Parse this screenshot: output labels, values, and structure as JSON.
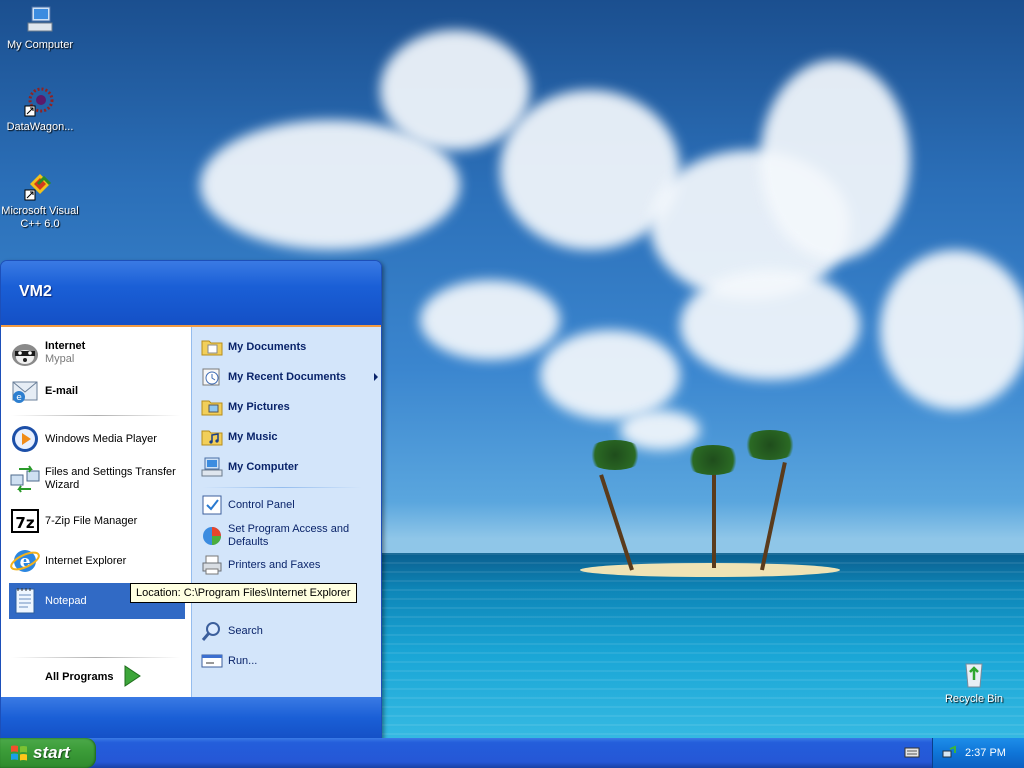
{
  "desktop": {
    "icons": [
      {
        "label": "My Computer"
      },
      {
        "label": "DataWagon..."
      },
      {
        "label": "Microsoft Visual\nC++ 6.0"
      },
      {
        "label": "Recycle Bin"
      }
    ]
  },
  "start_menu": {
    "user_name": "VM2",
    "pinned": [
      {
        "title": "Internet",
        "subtitle": "Mypal"
      },
      {
        "title": "E-mail",
        "subtitle": ""
      }
    ],
    "recent": [
      {
        "label": "Windows Media Player"
      },
      {
        "label": "Files and Settings Transfer Wizard"
      },
      {
        "label": "7-Zip File Manager"
      },
      {
        "label": "Internet Explorer"
      },
      {
        "label": "Notepad"
      }
    ],
    "all_programs": "All Programs",
    "places": [
      {
        "label": "My Documents"
      },
      {
        "label": "My Recent Documents"
      },
      {
        "label": "My Pictures"
      },
      {
        "label": "My Music"
      },
      {
        "label": "My Computer"
      }
    ],
    "settings": [
      {
        "label": "Control Panel"
      },
      {
        "label": "Set Program Access and Defaults"
      },
      {
        "label": "Printers and Faxes"
      },
      {
        "label": "Search"
      },
      {
        "label": "Run..."
      }
    ],
    "tooltip": "Location: C:\\Program Files\\Internet Explorer"
  },
  "taskbar": {
    "start_label": "start",
    "clock": "2:37 PM"
  },
  "colors": {
    "menu_blue": "#1450c6",
    "highlight": "#316ac5",
    "start_green": "#3c9d39",
    "tray_blue": "#0f75d8"
  }
}
